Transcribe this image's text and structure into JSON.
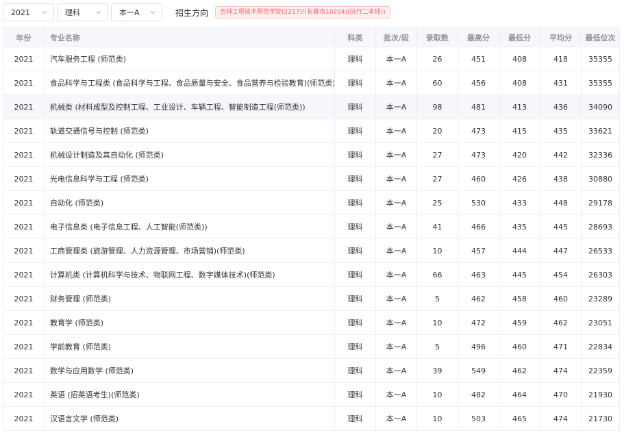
{
  "filters": {
    "year": "2021",
    "subject": "理科",
    "batch": "本一A",
    "direction_label": "招生方向",
    "direction_tag": "吉林工程技术师范学院(2217)((长春市10204)(执行二本线))"
  },
  "table": {
    "headers": [
      "年份",
      "专业名称",
      "科类",
      "批次/段",
      "录取数",
      "最高分",
      "最低分",
      "平均分",
      "最低位次"
    ],
    "rows": [
      [
        "2021",
        "汽车服务工程 (师范类)",
        "理科",
        "本一A",
        "26",
        "451",
        "408",
        "418",
        "35355"
      ],
      [
        "2021",
        "食品科学与工程类 (食品科学与工程、食品质量与安全、食品营养与检验教育)(师范类)",
        "理科",
        "本一A",
        "60",
        "456",
        "408",
        "431",
        "35355"
      ],
      [
        "2021",
        "机械类 (材料成型及控制工程、工业设计、车辆工程、智能制造工程(师范类))",
        "理科",
        "本一A",
        "98",
        "481",
        "413",
        "436",
        "34090"
      ],
      [
        "2021",
        "轨道交通信号与控制 (师范类)",
        "理科",
        "本一A",
        "20",
        "473",
        "415",
        "435",
        "33621"
      ],
      [
        "2021",
        "机械设计制造及其自动化 (师范类)",
        "理科",
        "本一A",
        "27",
        "473",
        "420",
        "442",
        "32336"
      ],
      [
        "2021",
        "光电信息科学与工程 (师范类)",
        "理科",
        "本一A",
        "27",
        "460",
        "426",
        "438",
        "30880"
      ],
      [
        "2021",
        "自动化 (师范类)",
        "理科",
        "本一A",
        "25",
        "530",
        "433",
        "448",
        "29178"
      ],
      [
        "2021",
        "电子信息类 (电子信息工程、人工智能(师范类))",
        "理科",
        "本一A",
        "41",
        "466",
        "435",
        "445",
        "28693"
      ],
      [
        "2021",
        "工商管理类 (旅游管理、人力资源管理、市场营销)(师范类)",
        "理科",
        "本一A",
        "10",
        "457",
        "444",
        "447",
        "26533"
      ],
      [
        "2021",
        "计算机类 (计算机科学与技术、物联网工程、数字媒体技术)(师范类)",
        "理科",
        "本一A",
        "66",
        "463",
        "445",
        "454",
        "26303"
      ],
      [
        "2021",
        "财务管理 (师范类)",
        "理科",
        "本一A",
        "5",
        "462",
        "458",
        "460",
        "23289"
      ],
      [
        "2021",
        "教育学 (师范类)",
        "理科",
        "本一A",
        "10",
        "472",
        "459",
        "462",
        "23051"
      ],
      [
        "2021",
        "学前教育 (师范类)",
        "理科",
        "本一A",
        "5",
        "496",
        "460",
        "471",
        "22834"
      ],
      [
        "2021",
        "数学与应用数学 (师范类)",
        "理科",
        "本一A",
        "39",
        "549",
        "462",
        "474",
        "22359"
      ],
      [
        "2021",
        "英语 (招英语考生)(师范类)",
        "理科",
        "本一A",
        "10",
        "482",
        "464",
        "470",
        "21930"
      ],
      [
        "2021",
        "汉语言文学 (师范类)",
        "理科",
        "本一A",
        "10",
        "503",
        "465",
        "474",
        "21730"
      ]
    ]
  }
}
